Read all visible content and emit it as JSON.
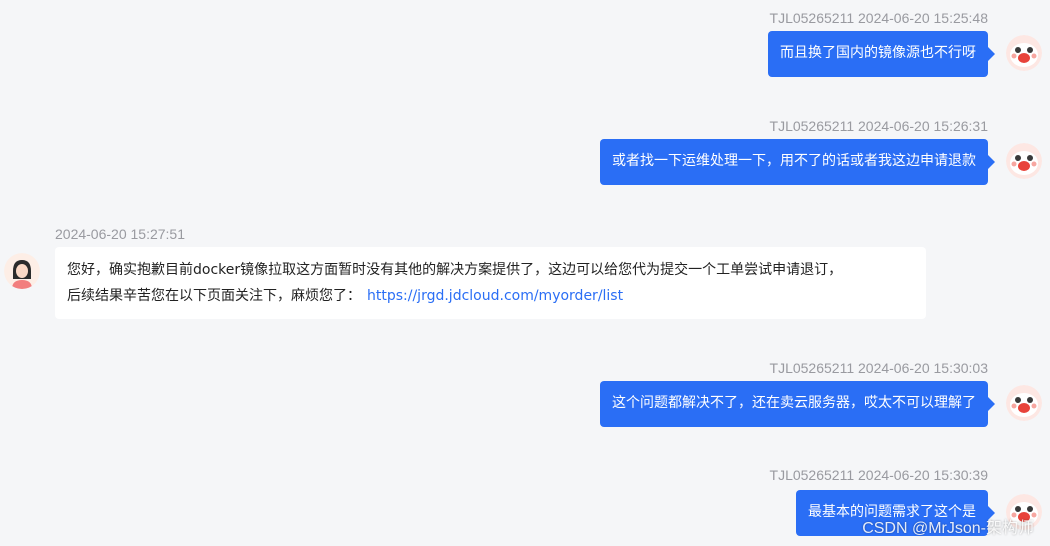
{
  "messages": [
    {
      "sender": "TJL05265211",
      "time": "2024-06-20 15:25:48",
      "text": "而且换了国内的镜像源也不行呀"
    },
    {
      "sender": "TJL05265211",
      "time": "2024-06-20 15:26:31",
      "text": "或者找一下运维处理一下，用不了的话或者我这边申请退款"
    },
    {
      "time": "2024-06-20 15:27:51",
      "line1": "您好，确实抱歉目前docker镜像拉取这方面暂时没有其他的解决方案提供了，这边可以给您代为提交一个工单尝试申请退订，",
      "line2": "后续结果辛苦您在以下页面关注下，麻烦您了：",
      "link": "https://jrgd.jdcloud.com/myorder/list"
    },
    {
      "sender": "TJL05265211",
      "time": "2024-06-20 15:30:03",
      "text": "这个问题都解决不了，还在卖云服务器，哎太不可以理解了"
    },
    {
      "sender": "TJL05265211",
      "time": "2024-06-20 15:30:39",
      "text": "最基本的问题需求了这个是"
    }
  ],
  "watermark": "CSDN @MrJson-架构师",
  "colors": {
    "background": "#f5f6f8",
    "bubble_out": "#2a6ef5",
    "bubble_in": "#ffffff",
    "meta_text": "#999aa0",
    "link": "#2a6ef5"
  }
}
